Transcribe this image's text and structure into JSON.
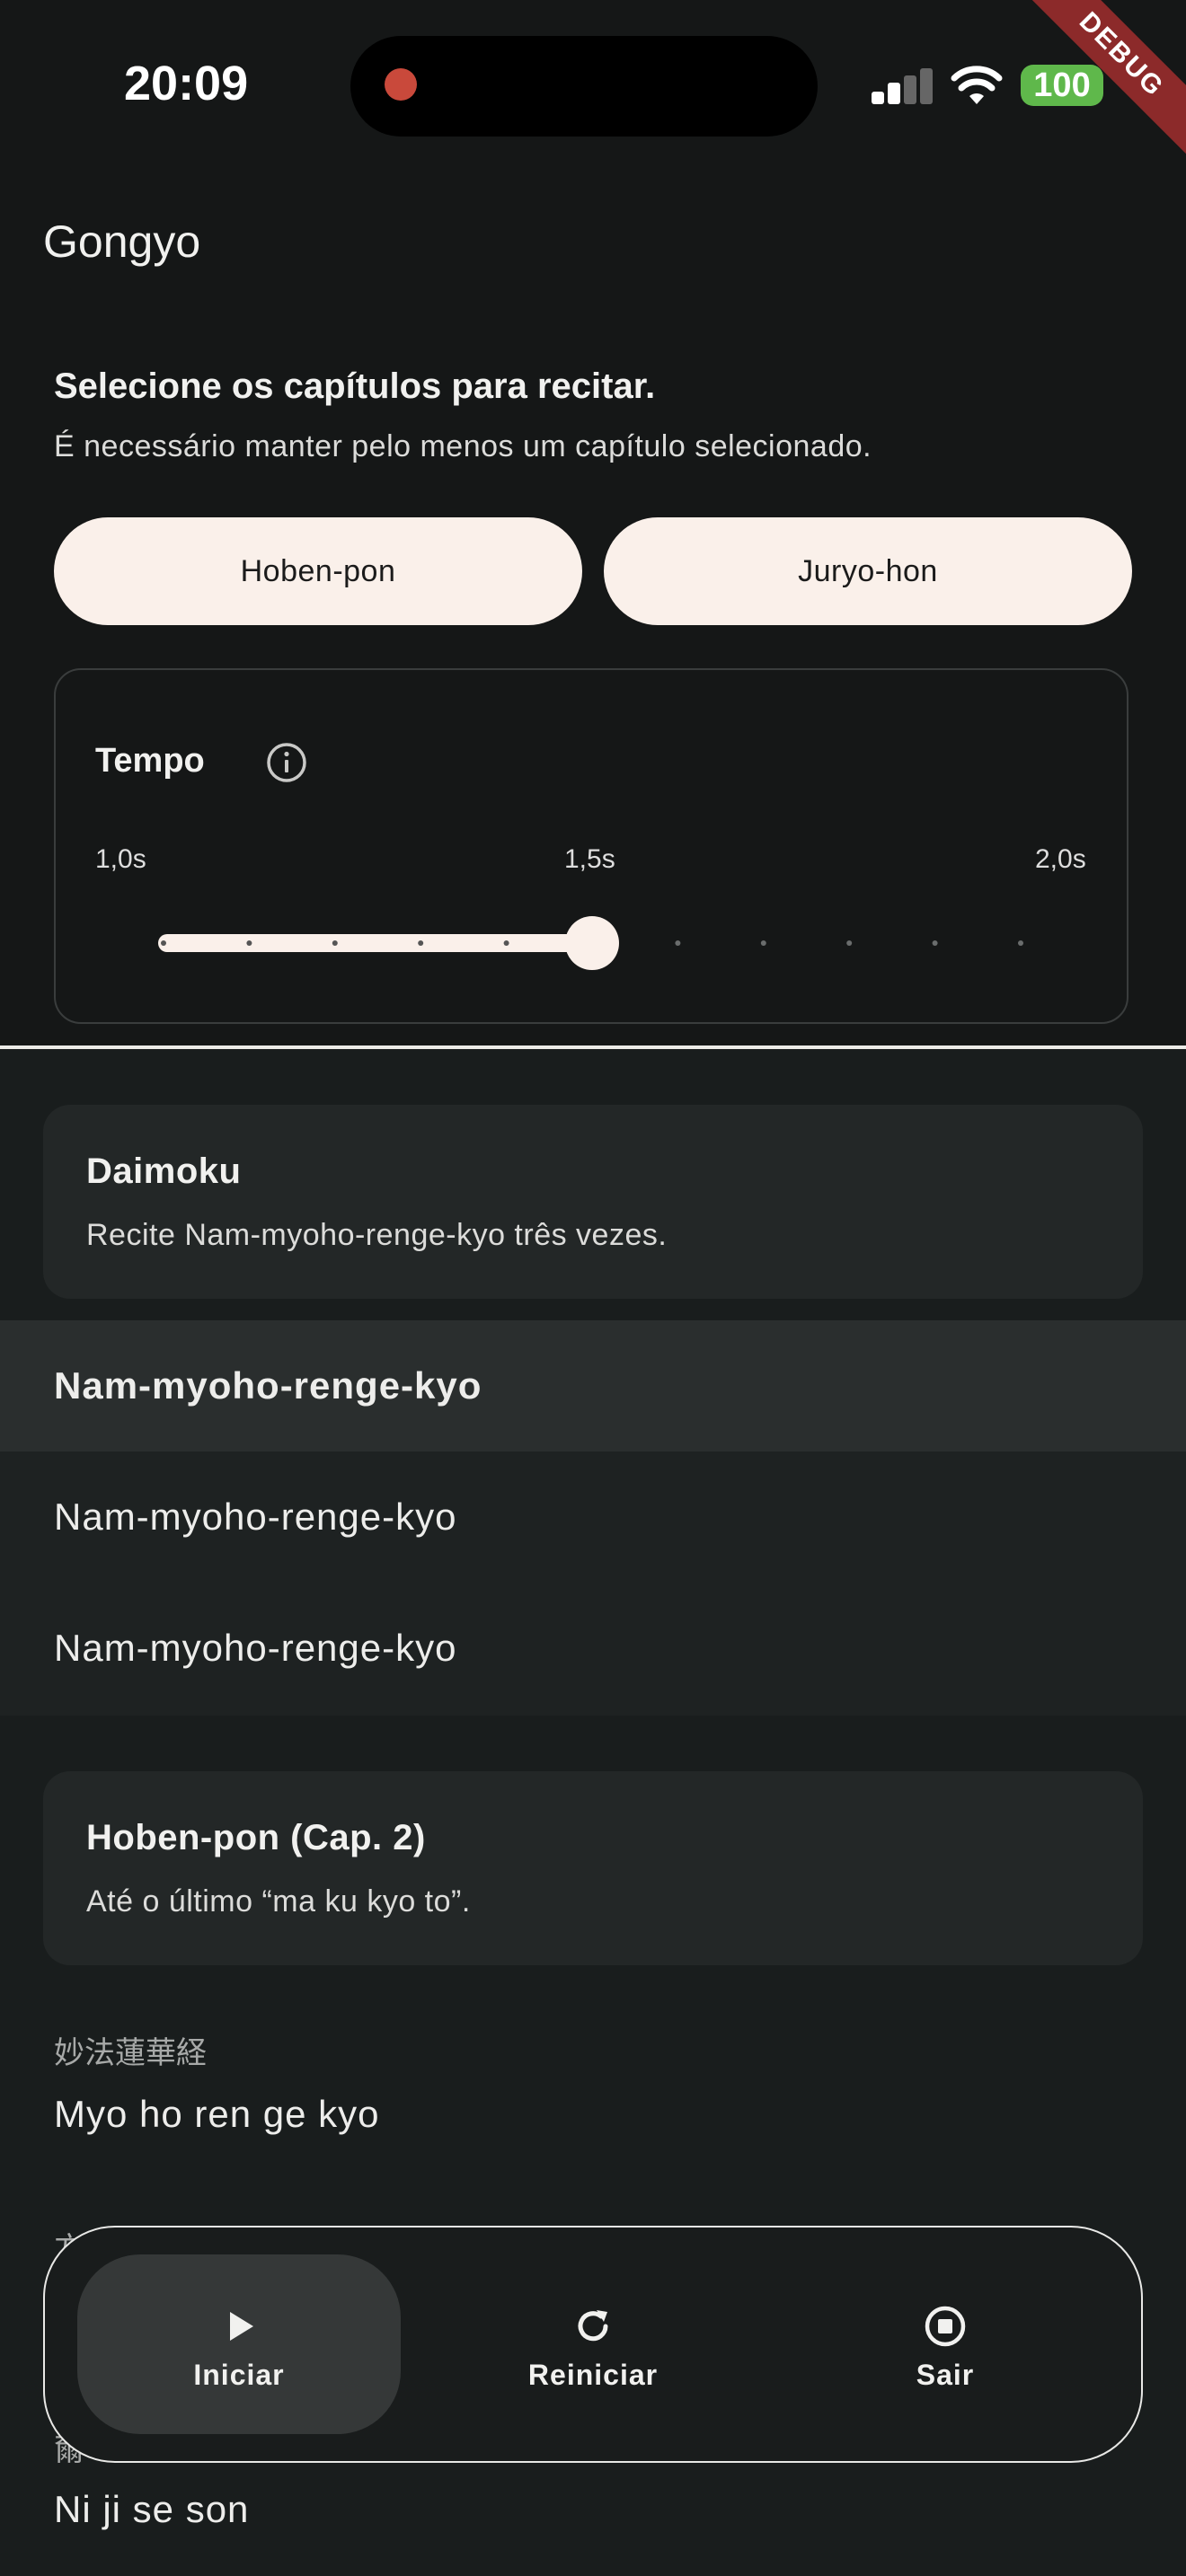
{
  "status_bar": {
    "time": "20:09",
    "battery": "100",
    "debug_banner": "DEBUG"
  },
  "app": {
    "title": "Gongyo"
  },
  "selection": {
    "title": "Selecione os capítulos para recitar.",
    "subtitle": "É necessário manter pelo menos um capítulo selecionado.",
    "chapters": [
      {
        "label": "Hoben-pon",
        "selected": true
      },
      {
        "label": "Juryo-hon",
        "selected": true
      }
    ]
  },
  "tempo": {
    "label": "Tempo",
    "info_icon": "info-icon",
    "ticks": [
      "1,0s",
      "1,5s",
      "2,0s"
    ],
    "min": 1.0,
    "max": 2.0,
    "step": 0.1,
    "value": 1.5
  },
  "daimoku": {
    "title": "Daimoku",
    "subtitle": "Recite Nam-myoho-renge-kyo três vezes.",
    "lines": [
      "Nam-myoho-renge-kyo",
      "Nam-myoho-renge-kyo",
      "Nam-myoho-renge-kyo"
    ],
    "active_index": 0
  },
  "hoben": {
    "title": "Hoben-pon (Cap. 2)",
    "subtitle": "Até o último “ma ku kyo to”.",
    "verse_kanji": "妙法蓮華経",
    "verse_romaji": "Myo ho ren ge kyo",
    "partial_kanji": "方",
    "partial_kanji_2": "爾",
    "verse2_romaji": "Ni ji se son"
  },
  "bottom_nav": {
    "start": {
      "label": "Iniciar",
      "icon": "play-icon"
    },
    "restart": {
      "label": "Reiniciar",
      "icon": "restart-icon"
    },
    "exit": {
      "label": "Sair",
      "icon": "stop-icon"
    }
  },
  "colors": {
    "chip_bg": "#faf0ea",
    "slider_active": "#faf0ea",
    "battery": "#5fb84b",
    "record": "#c9493b"
  }
}
